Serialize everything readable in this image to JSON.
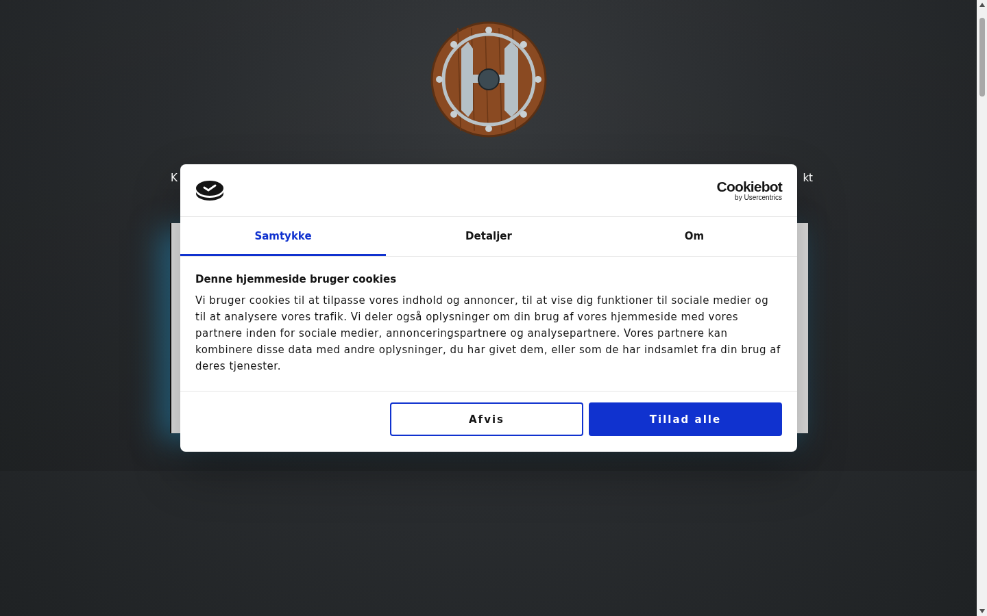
{
  "nav": {
    "items": [
      "K",
      "kt"
    ]
  },
  "dialog": {
    "brand": {
      "name": "Cookiebot",
      "byline": "by Usercentrics"
    },
    "tabs": [
      {
        "label": "Samtykke",
        "selected": true
      },
      {
        "label": "Detaljer",
        "selected": false
      },
      {
        "label": "Om",
        "selected": false
      }
    ],
    "heading": "Denne hjemmeside bruger cookies",
    "body": "Vi bruger cookies til at tilpasse vores indhold og annoncer, til at vise dig funktioner til sociale medier og til at analysere vores trafik. Vi deler også oplysninger om din brug af vores hjemmeside med vores partnere inden for sociale medier, annonceringspartnere og analysepartnere. Vores partnere kan kombinere disse data med andre oplysninger, du har givet dem, eller som de har indsamlet fra din brug af deres tjenester.",
    "buttons": [
      {
        "label": "Afvis",
        "kind": "outline"
      },
      {
        "label": "Tillad alle",
        "kind": "primary"
      }
    ]
  }
}
